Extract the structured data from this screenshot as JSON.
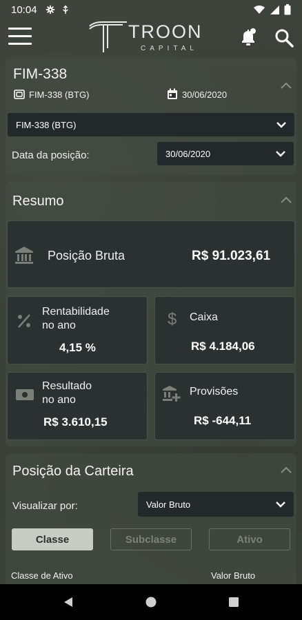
{
  "status_bar": {
    "time": "10:04"
  },
  "header": {
    "brand": "TROON",
    "brand_sub": "CAPITAL"
  },
  "fund": {
    "title": "FIM-338",
    "fund_badge": "FIM-338 (BTG)",
    "date_badge": "30/06/2020",
    "fund_select": "FIM-338 (BTG)",
    "date_label": "Data da posição:",
    "date_select": "30/06/2020"
  },
  "resumo": {
    "title": "Resumo",
    "posicao_bruta_label": "Posição Bruta",
    "posicao_bruta_value": "R$ 91.023,61",
    "rentabilidade_label_1": "Rentabilidade",
    "rentabilidade_label_2": "no ano",
    "rentabilidade_value": "4,15 %",
    "caixa_label": "Caixa",
    "caixa_value": "R$ 4.184,06",
    "resultado_label_1": "Resultado",
    "resultado_label_2": "no ano",
    "resultado_value": "R$ 3.610,15",
    "provisoes_label": "Provisões",
    "provisoes_value": "R$ -644,11"
  },
  "carteira": {
    "title": "Posição da Carteira",
    "view_label": "Visualizar por:",
    "view_select": "Valor Bruto",
    "tabs": [
      "Classe",
      "Subclasse",
      "Ativo"
    ],
    "col_left": "Classe de Ativo",
    "col_right": "Valor Bruto"
  },
  "colors": {
    "card_bg": "#2b3030",
    "dropdown_bg": "#23282a",
    "active_tab": "#c9ccc4"
  }
}
